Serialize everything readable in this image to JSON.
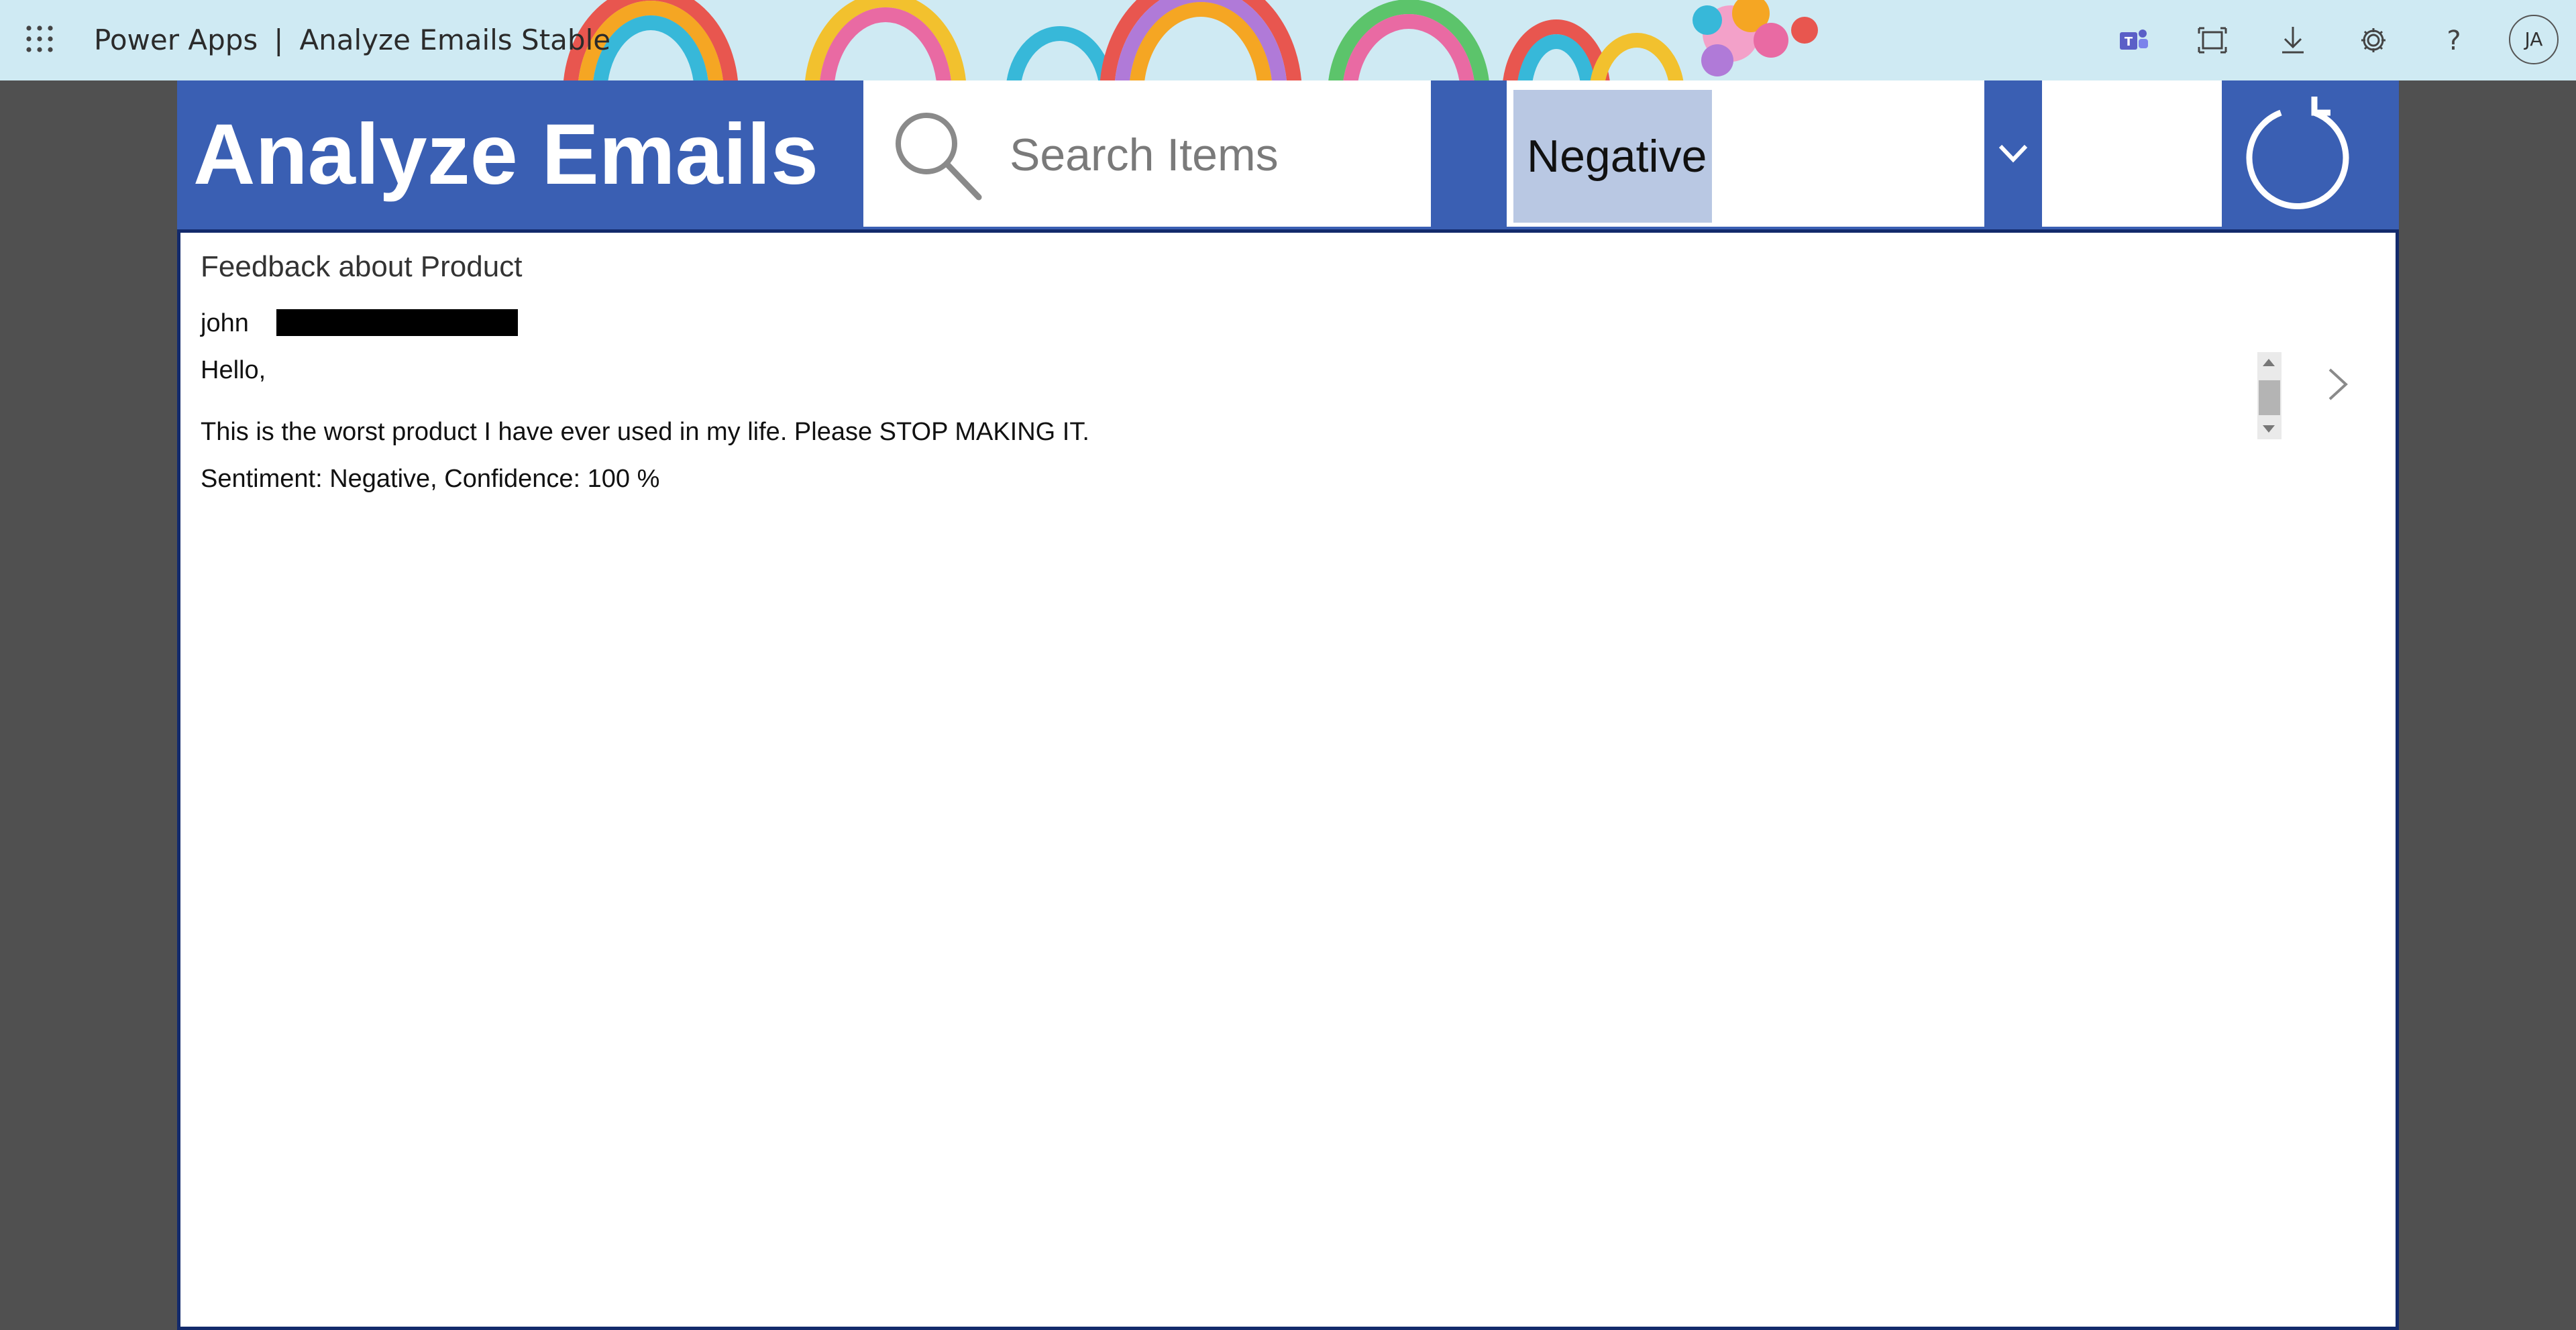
{
  "topbar": {
    "app_name": "Power Apps",
    "separator": "|",
    "app_title": "Analyze Emails Stable",
    "icons": [
      "waffle-icon",
      "teams-icon",
      "fit-to-window-icon",
      "download-icon",
      "settings-icon",
      "help-icon"
    ],
    "avatar_initials": "JA"
  },
  "header": {
    "title": "Analyze Emails",
    "search_placeholder": "Search Items",
    "filter_selected": "Negative",
    "color": "#3a5fb3"
  },
  "gallery": {
    "items": [
      {
        "subject": "Feedback about Product",
        "sender_visible": "john",
        "greeting": "Hello,",
        "body": "This is the worst product I have ever used in my life. Please STOP MAKING IT.",
        "sentiment_line": "Sentiment: Negative, Confidence: 100 %"
      }
    ]
  }
}
